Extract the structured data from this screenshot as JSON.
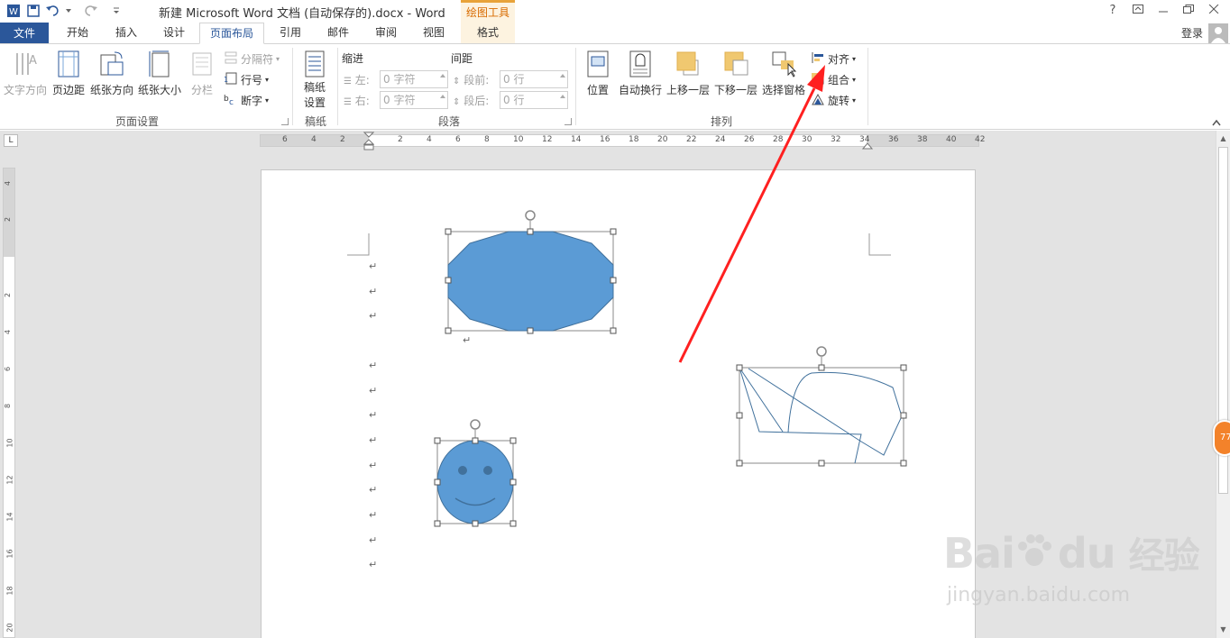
{
  "titlebar": {
    "title": "新建 Microsoft Word 文档 (自动保存的).docx - Word",
    "context_group": "绘图工具",
    "help": "?",
    "login": "登录"
  },
  "tabs": [
    {
      "label": "文件"
    },
    {
      "label": "开始"
    },
    {
      "label": "插入"
    },
    {
      "label": "设计"
    },
    {
      "label": "页面布局"
    },
    {
      "label": "引用"
    },
    {
      "label": "邮件"
    },
    {
      "label": "审阅"
    },
    {
      "label": "视图"
    },
    {
      "label": "格式"
    }
  ],
  "active_tab": "页面布局",
  "ribbon": {
    "page_setup": {
      "label": "页面设置",
      "text_direction": "文字方向",
      "margins": "页边距",
      "orientation": "纸张方向",
      "size": "纸张大小",
      "columns": "分栏",
      "breaks": "分隔符",
      "line_numbers": "行号",
      "hyphenation": "断字"
    },
    "draft": {
      "label": "稿纸",
      "setup_line1": "稿纸",
      "setup_line2": "设置"
    },
    "paragraph": {
      "label": "段落",
      "indent_header": "缩进",
      "spacing_header": "间距",
      "left_label": "左:",
      "right_label": "右:",
      "before_label": "段前:",
      "after_label": "段后:",
      "left_value": "0 字符",
      "right_value": "0 字符",
      "before_value": "0 行",
      "after_value": "0 行"
    },
    "arrange": {
      "label": "排列",
      "position": "位置",
      "wrap_text": "自动换行",
      "bring_forward": "上移一层",
      "send_backward": "下移一层",
      "selection_pane": "选择窗格",
      "align": "对齐",
      "group": "组合",
      "rotate": "旋转"
    }
  },
  "ruler": {
    "h_ticks": [
      "6",
      "4",
      "2",
      "2",
      "4",
      "6",
      "8",
      "10",
      "12",
      "14",
      "16",
      "18",
      "20",
      "22",
      "24",
      "26",
      "28",
      "30",
      "32",
      "34",
      "36",
      "38",
      "40",
      "42"
    ],
    "v_ticks": [
      "4",
      "2",
      "2",
      "4",
      "6",
      "8",
      "10",
      "12",
      "14",
      "16",
      "18",
      "20"
    ]
  },
  "badge": "77",
  "watermark": {
    "brand": "Bai",
    "brand2": "du",
    "cn": "经验",
    "url": "jingyan.baidu.com"
  },
  "colors": {
    "file_tab": "#2b579a",
    "shape_fill": "#5b9bd5",
    "shape_stroke": "#41719c",
    "arrow": "#ff2020",
    "context": "#d86b00"
  }
}
